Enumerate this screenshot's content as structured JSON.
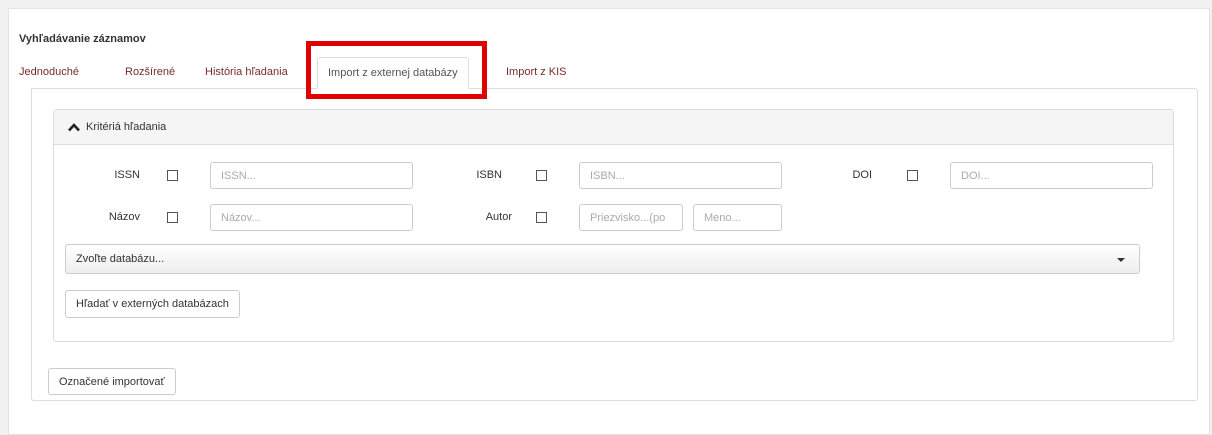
{
  "page": {
    "title": "Vyhľadávanie záznamov"
  },
  "tabs": [
    {
      "label": "Jednoduché"
    },
    {
      "label": "Rozšírené"
    },
    {
      "label": "História hľadania"
    },
    {
      "label": "Import z externej databázy",
      "active": true
    },
    {
      "label": "Import z KIS"
    }
  ],
  "panel": {
    "title": "Kritériá hľadania",
    "icon": "chevron-up-icon"
  },
  "criteria": {
    "issn": {
      "label": "ISSN",
      "placeholder": "ISSN..."
    },
    "isbn": {
      "label": "ISBN",
      "placeholder": "ISBN..."
    },
    "doi": {
      "label": "DOI",
      "placeholder": "DOI..."
    },
    "nazov": {
      "label": "Názov",
      "placeholder": "Názov..."
    },
    "autor": {
      "label": "Autor",
      "surname_placeholder": "Priezvisko...(po",
      "name_placeholder": "Meno..."
    }
  },
  "database_select": {
    "placeholder": "Zvoľte databázu..."
  },
  "buttons": {
    "search_external": "Hľadať v externých databázach",
    "import_marked": "Označené importovať"
  },
  "colors": {
    "tab_link": "#7a2a2a",
    "highlight_border": "#e00000"
  }
}
